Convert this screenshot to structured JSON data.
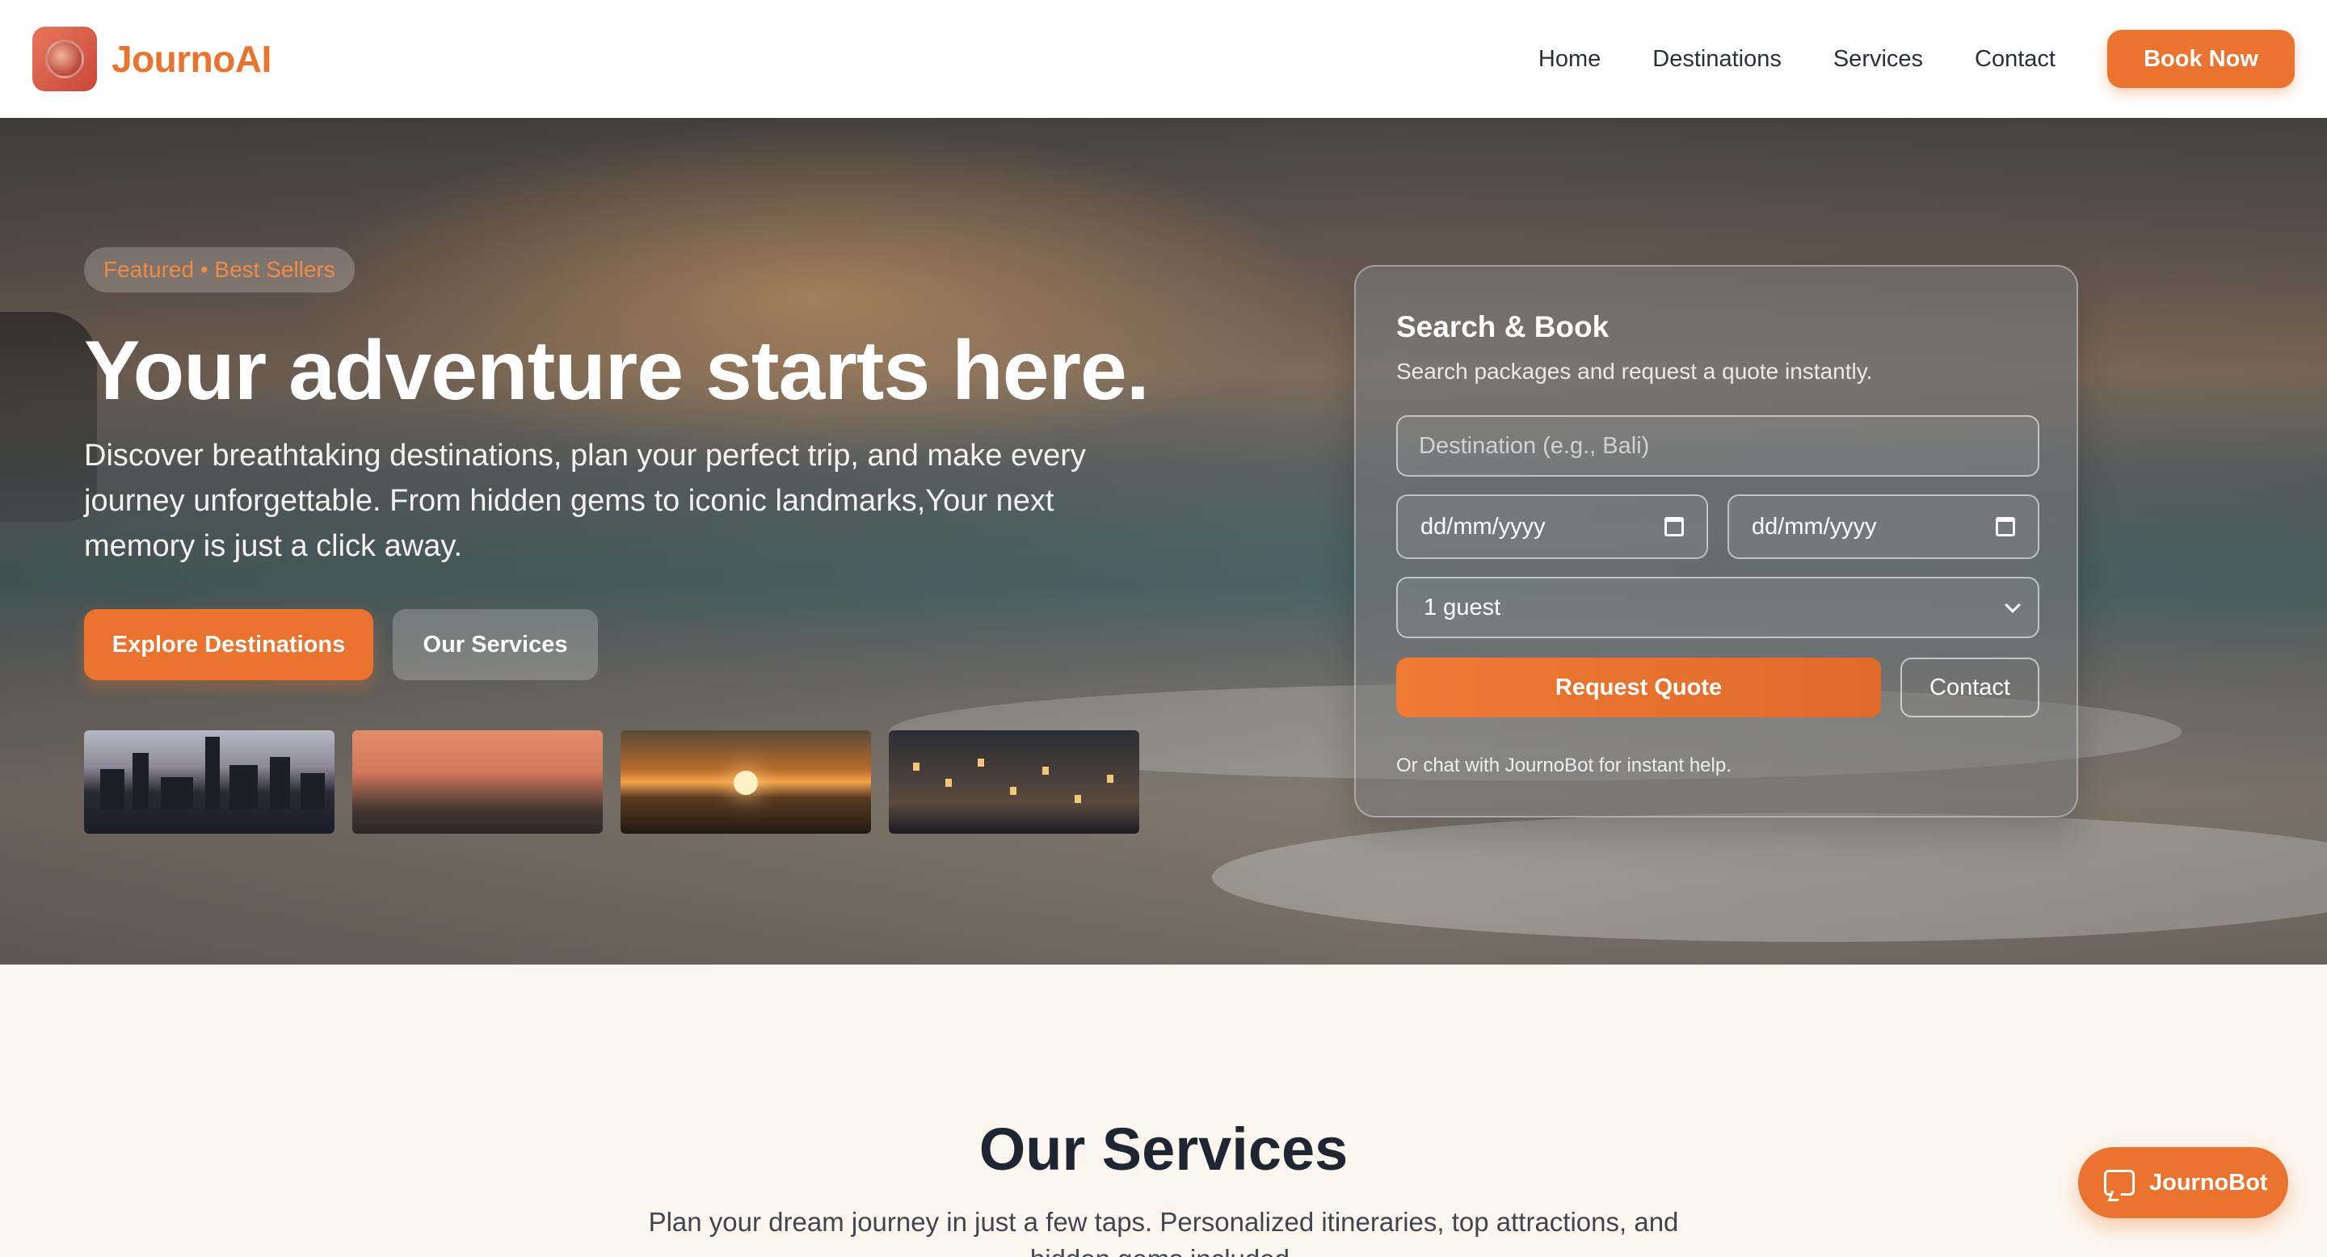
{
  "brand": {
    "name": "JournoAI",
    "icon": "globe-logo-icon",
    "accent": "#e9732f"
  },
  "nav": {
    "items": [
      {
        "label": "Home"
      },
      {
        "label": "Destinations"
      },
      {
        "label": "Services"
      },
      {
        "label": "Contact"
      }
    ],
    "cta": "Book Now"
  },
  "hero": {
    "badge": "Featured • Best Sellers",
    "title": "Your adventure starts here.",
    "description": "Discover breathtaking destinations, plan your perfect trip, and make every journey unforgettable. From hidden gems to iconic landmarks,Your next memory is just a click away.",
    "primary_button": "Explore Destinations",
    "secondary_button": "Our Services",
    "thumbnails": [
      "city-skyline-image",
      "temple-sunset-image",
      "ocean-sunset-image",
      "canal-houses-image"
    ]
  },
  "search": {
    "title": "Search & Book",
    "subtitle": "Search packages and request a quote instantly.",
    "destination_placeholder": "Destination (e.g., Bali)",
    "date_start": "dd/mm/yyyy",
    "date_end": "dd/mm/yyyy",
    "guests": "1 guest",
    "quote_button": "Request Quote",
    "contact_button": "Contact",
    "note": "Or chat with JournoBot for instant help."
  },
  "services": {
    "title": "Our Services",
    "description": "Plan your dream journey in just a few taps. Personalized itineraries, top attractions, and hidden gems included."
  },
  "chat": {
    "label": "JournoBot",
    "icon": "chat-bubble-icon"
  }
}
